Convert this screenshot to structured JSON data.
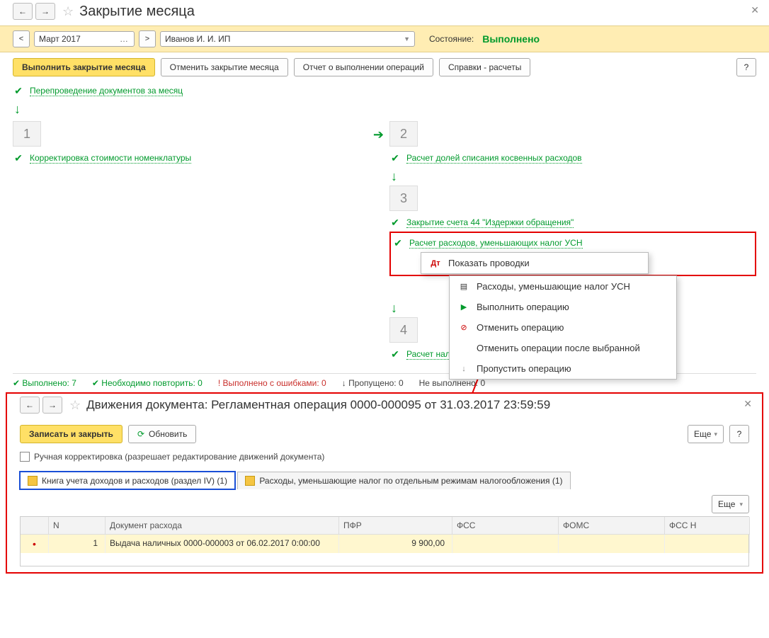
{
  "main": {
    "title": "Закрытие месяца",
    "period": "Март 2017",
    "organization": "Иванов И. И. ИП",
    "status_label": "Состояние:",
    "status_value": "Выполнено",
    "btn_execute": "Выполнить закрытие месяца",
    "btn_cancel": "Отменить закрытие месяца",
    "btn_report": "Отчет о выполнении операций",
    "btn_calc": "Справки - расчеты",
    "op_repost": "Перепроведение документов за месяц",
    "stage1_op": "Корректировка стоимости номенклатуры",
    "stage2_op": "Расчет долей списания косвенных расходов",
    "stage3_op1": "Закрытие счета 44 \"Издержки обращения\"",
    "stage3_op2": "Расчет расходов, уменьшающих налог УСН",
    "stage4_op": "Расчет налога УСН",
    "context": {
      "show_entries": "Показать проводки",
      "expenses": "Расходы, уменьшающие налог УСН",
      "execute": "Выполнить операцию",
      "cancel": "Отменить операцию",
      "cancel_after": "Отменить операции после выбранной",
      "skip": "Пропустить операцию"
    },
    "sb": {
      "done_l": "Выполнено:",
      "done_v": "7",
      "repeat_l": "Необходимо повторить:",
      "repeat_v": "0",
      "errors_l": "Выполнено с ошибками:",
      "errors_v": "0",
      "skipped_l": "Пропущено:",
      "skipped_v": "0",
      "notdone_l": "Не выполнено:",
      "notdone_v": "0"
    }
  },
  "doc": {
    "title": "Движения документа: Регламентная операция 0000-000095 от 31.03.2017 23:59:59",
    "btn_save": "Записать и закрыть",
    "btn_refresh": "Обновить",
    "btn_more": "Еще",
    "manual_edit": "Ручная корректировка (разрешает редактирование движений документа)",
    "tab1": "Книга учета доходов и расходов (раздел IV) (1)",
    "tab2": "Расходы, уменьшающие налог по отдельным режимам налогообложения (1)",
    "cols": {
      "n": "N",
      "doc": "Документ расхода",
      "pfr": "ПФР",
      "fss": "ФСС",
      "foms": "ФОМС",
      "fssn": "ФСС Н"
    },
    "row": {
      "n": "1",
      "doc": "Выдача наличных 0000-000003 от 06.02.2017 0:00:00",
      "pfr": "9 900,00"
    }
  }
}
